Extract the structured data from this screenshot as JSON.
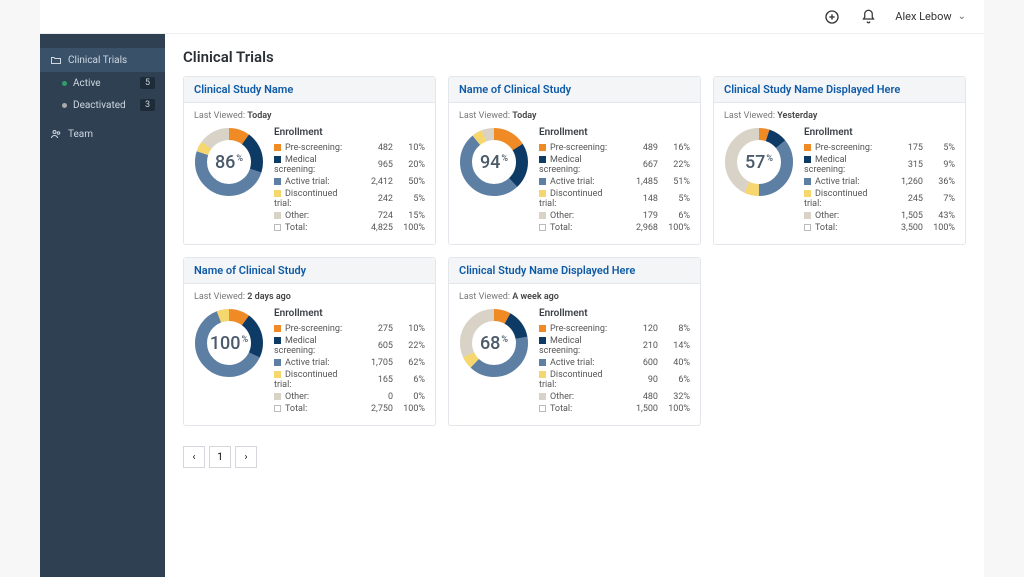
{
  "header": {
    "user_name": "Alex Lebow"
  },
  "sidebar": {
    "trials": {
      "label": "Clinical Trials"
    },
    "active": {
      "label": "Active",
      "count": "5"
    },
    "deactivated": {
      "label": "Deactivated",
      "count": "3"
    },
    "team": {
      "label": "Team"
    }
  },
  "page": {
    "title": "Clinical Trials"
  },
  "enrollment_heading": "Enrollment",
  "last_viewed_label": "Last Viewed: ",
  "row_labels": {
    "pre": "Pre-screening:",
    "med": "Medical screening:",
    "act": "Active trial:",
    "dis": "Discontinued trial:",
    "oth": "Other:",
    "tot": "Total:"
  },
  "colors": {
    "pre": "#f08a24",
    "med": "#0e3a66",
    "act": "#5c7fa3",
    "dis": "#f5d76e",
    "oth": "#d9d3c7",
    "tot": "#ffffff",
    "ring_bg": "#e6e6e6"
  },
  "pager": {
    "prev": "‹",
    "page": "1",
    "next": "›"
  },
  "cards": [
    {
      "title": "Clinical Study Name",
      "last_viewed": "Today",
      "center_pct": "86",
      "rows": {
        "pre": {
          "n": "482",
          "p": "10%"
        },
        "med": {
          "n": "965",
          "p": "20%"
        },
        "act": {
          "n": "2,412",
          "p": "50%"
        },
        "dis": {
          "n": "242",
          "p": "5%"
        },
        "oth": {
          "n": "724",
          "p": "15%"
        },
        "tot": {
          "n": "4,825",
          "p": "100%"
        }
      },
      "segments": [
        10,
        20,
        50,
        5,
        15
      ]
    },
    {
      "title": "Name of Clinical Study",
      "last_viewed": "Today",
      "center_pct": "94",
      "rows": {
        "pre": {
          "n": "489",
          "p": "16%"
        },
        "med": {
          "n": "667",
          "p": "22%"
        },
        "act": {
          "n": "1,485",
          "p": "51%"
        },
        "dis": {
          "n": "148",
          "p": "5%"
        },
        "oth": {
          "n": "179",
          "p": "6%"
        },
        "tot": {
          "n": "2,968",
          "p": "100%"
        }
      },
      "segments": [
        16,
        22,
        51,
        5,
        6
      ]
    },
    {
      "title": "Clinical Study Name Displayed Here",
      "last_viewed": "Yesterday",
      "center_pct": "57",
      "rows": {
        "pre": {
          "n": "175",
          "p": "5%"
        },
        "med": {
          "n": "315",
          "p": "9%"
        },
        "act": {
          "n": "1,260",
          "p": "36%"
        },
        "dis": {
          "n": "245",
          "p": "7%"
        },
        "oth": {
          "n": "1,505",
          "p": "43%"
        },
        "tot": {
          "n": "3,500",
          "p": "100%"
        }
      },
      "segments": [
        5,
        9,
        36,
        7,
        43
      ]
    },
    {
      "title": "Name of Clinical Study",
      "last_viewed": "2 days ago",
      "center_pct": "100",
      "rows": {
        "pre": {
          "n": "275",
          "p": "10%"
        },
        "med": {
          "n": "605",
          "p": "22%"
        },
        "act": {
          "n": "1,705",
          "p": "62%"
        },
        "dis": {
          "n": "165",
          "p": "6%"
        },
        "oth": {
          "n": "0",
          "p": "0%"
        },
        "tot": {
          "n": "2,750",
          "p": "100%"
        }
      },
      "segments": [
        10,
        22,
        62,
        6,
        0
      ]
    },
    {
      "title": "Clinical Study Name Displayed Here",
      "last_viewed": "A week ago",
      "center_pct": "68",
      "rows": {
        "pre": {
          "n": "120",
          "p": "8%"
        },
        "med": {
          "n": "210",
          "p": "14%"
        },
        "act": {
          "n": "600",
          "p": "40%"
        },
        "dis": {
          "n": "90",
          "p": "6%"
        },
        "oth": {
          "n": "480",
          "p": "32%"
        },
        "tot": {
          "n": "1,500",
          "p": "100%"
        }
      },
      "segments": [
        8,
        14,
        40,
        6,
        32
      ]
    }
  ],
  "chart_data": [
    {
      "type": "pie",
      "title": "Clinical Study Name",
      "categories": [
        "Pre-screening",
        "Medical screening",
        "Active trial",
        "Discontinued trial",
        "Other"
      ],
      "values": [
        10,
        20,
        50,
        5,
        15
      ]
    },
    {
      "type": "pie",
      "title": "Name of Clinical Study",
      "categories": [
        "Pre-screening",
        "Medical screening",
        "Active trial",
        "Discontinued trial",
        "Other"
      ],
      "values": [
        16,
        22,
        51,
        5,
        6
      ]
    },
    {
      "type": "pie",
      "title": "Clinical Study Name Displayed Here",
      "categories": [
        "Pre-screening",
        "Medical screening",
        "Active trial",
        "Discontinued trial",
        "Other"
      ],
      "values": [
        5,
        9,
        36,
        7,
        43
      ]
    },
    {
      "type": "pie",
      "title": "Name of Clinical Study",
      "categories": [
        "Pre-screening",
        "Medical screening",
        "Active trial",
        "Discontinued trial",
        "Other"
      ],
      "values": [
        10,
        22,
        62,
        6,
        0
      ]
    },
    {
      "type": "pie",
      "title": "Clinical Study Name Displayed Here",
      "categories": [
        "Pre-screening",
        "Medical screening",
        "Active trial",
        "Discontinued trial",
        "Other"
      ],
      "values": [
        8,
        14,
        40,
        6,
        32
      ]
    }
  ]
}
